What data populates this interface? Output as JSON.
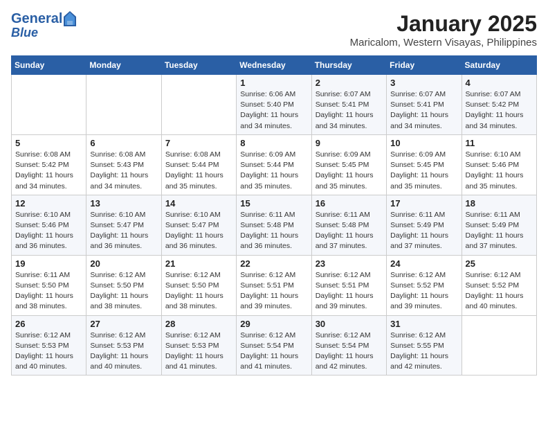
{
  "header": {
    "logo_line1": "General",
    "logo_line2": "Blue",
    "month_title": "January 2025",
    "subtitle": "Maricalom, Western Visayas, Philippines"
  },
  "days_of_week": [
    "Sunday",
    "Monday",
    "Tuesday",
    "Wednesday",
    "Thursday",
    "Friday",
    "Saturday"
  ],
  "weeks": [
    [
      {
        "day": "",
        "info": ""
      },
      {
        "day": "",
        "info": ""
      },
      {
        "day": "",
        "info": ""
      },
      {
        "day": "1",
        "info": "Sunrise: 6:06 AM\nSunset: 5:40 PM\nDaylight: 11 hours and 34 minutes."
      },
      {
        "day": "2",
        "info": "Sunrise: 6:07 AM\nSunset: 5:41 PM\nDaylight: 11 hours and 34 minutes."
      },
      {
        "day": "3",
        "info": "Sunrise: 6:07 AM\nSunset: 5:41 PM\nDaylight: 11 hours and 34 minutes."
      },
      {
        "day": "4",
        "info": "Sunrise: 6:07 AM\nSunset: 5:42 PM\nDaylight: 11 hours and 34 minutes."
      }
    ],
    [
      {
        "day": "5",
        "info": "Sunrise: 6:08 AM\nSunset: 5:42 PM\nDaylight: 11 hours and 34 minutes."
      },
      {
        "day": "6",
        "info": "Sunrise: 6:08 AM\nSunset: 5:43 PM\nDaylight: 11 hours and 34 minutes."
      },
      {
        "day": "7",
        "info": "Sunrise: 6:08 AM\nSunset: 5:44 PM\nDaylight: 11 hours and 35 minutes."
      },
      {
        "day": "8",
        "info": "Sunrise: 6:09 AM\nSunset: 5:44 PM\nDaylight: 11 hours and 35 minutes."
      },
      {
        "day": "9",
        "info": "Sunrise: 6:09 AM\nSunset: 5:45 PM\nDaylight: 11 hours and 35 minutes."
      },
      {
        "day": "10",
        "info": "Sunrise: 6:09 AM\nSunset: 5:45 PM\nDaylight: 11 hours and 35 minutes."
      },
      {
        "day": "11",
        "info": "Sunrise: 6:10 AM\nSunset: 5:46 PM\nDaylight: 11 hours and 35 minutes."
      }
    ],
    [
      {
        "day": "12",
        "info": "Sunrise: 6:10 AM\nSunset: 5:46 PM\nDaylight: 11 hours and 36 minutes."
      },
      {
        "day": "13",
        "info": "Sunrise: 6:10 AM\nSunset: 5:47 PM\nDaylight: 11 hours and 36 minutes."
      },
      {
        "day": "14",
        "info": "Sunrise: 6:10 AM\nSunset: 5:47 PM\nDaylight: 11 hours and 36 minutes."
      },
      {
        "day": "15",
        "info": "Sunrise: 6:11 AM\nSunset: 5:48 PM\nDaylight: 11 hours and 36 minutes."
      },
      {
        "day": "16",
        "info": "Sunrise: 6:11 AM\nSunset: 5:48 PM\nDaylight: 11 hours and 37 minutes."
      },
      {
        "day": "17",
        "info": "Sunrise: 6:11 AM\nSunset: 5:49 PM\nDaylight: 11 hours and 37 minutes."
      },
      {
        "day": "18",
        "info": "Sunrise: 6:11 AM\nSunset: 5:49 PM\nDaylight: 11 hours and 37 minutes."
      }
    ],
    [
      {
        "day": "19",
        "info": "Sunrise: 6:11 AM\nSunset: 5:50 PM\nDaylight: 11 hours and 38 minutes."
      },
      {
        "day": "20",
        "info": "Sunrise: 6:12 AM\nSunset: 5:50 PM\nDaylight: 11 hours and 38 minutes."
      },
      {
        "day": "21",
        "info": "Sunrise: 6:12 AM\nSunset: 5:50 PM\nDaylight: 11 hours and 38 minutes."
      },
      {
        "day": "22",
        "info": "Sunrise: 6:12 AM\nSunset: 5:51 PM\nDaylight: 11 hours and 39 minutes."
      },
      {
        "day": "23",
        "info": "Sunrise: 6:12 AM\nSunset: 5:51 PM\nDaylight: 11 hours and 39 minutes."
      },
      {
        "day": "24",
        "info": "Sunrise: 6:12 AM\nSunset: 5:52 PM\nDaylight: 11 hours and 39 minutes."
      },
      {
        "day": "25",
        "info": "Sunrise: 6:12 AM\nSunset: 5:52 PM\nDaylight: 11 hours and 40 minutes."
      }
    ],
    [
      {
        "day": "26",
        "info": "Sunrise: 6:12 AM\nSunset: 5:53 PM\nDaylight: 11 hours and 40 minutes."
      },
      {
        "day": "27",
        "info": "Sunrise: 6:12 AM\nSunset: 5:53 PM\nDaylight: 11 hours and 40 minutes."
      },
      {
        "day": "28",
        "info": "Sunrise: 6:12 AM\nSunset: 5:53 PM\nDaylight: 11 hours and 41 minutes."
      },
      {
        "day": "29",
        "info": "Sunrise: 6:12 AM\nSunset: 5:54 PM\nDaylight: 11 hours and 41 minutes."
      },
      {
        "day": "30",
        "info": "Sunrise: 6:12 AM\nSunset: 5:54 PM\nDaylight: 11 hours and 42 minutes."
      },
      {
        "day": "31",
        "info": "Sunrise: 6:12 AM\nSunset: 5:55 PM\nDaylight: 11 hours and 42 minutes."
      },
      {
        "day": "",
        "info": ""
      }
    ]
  ]
}
